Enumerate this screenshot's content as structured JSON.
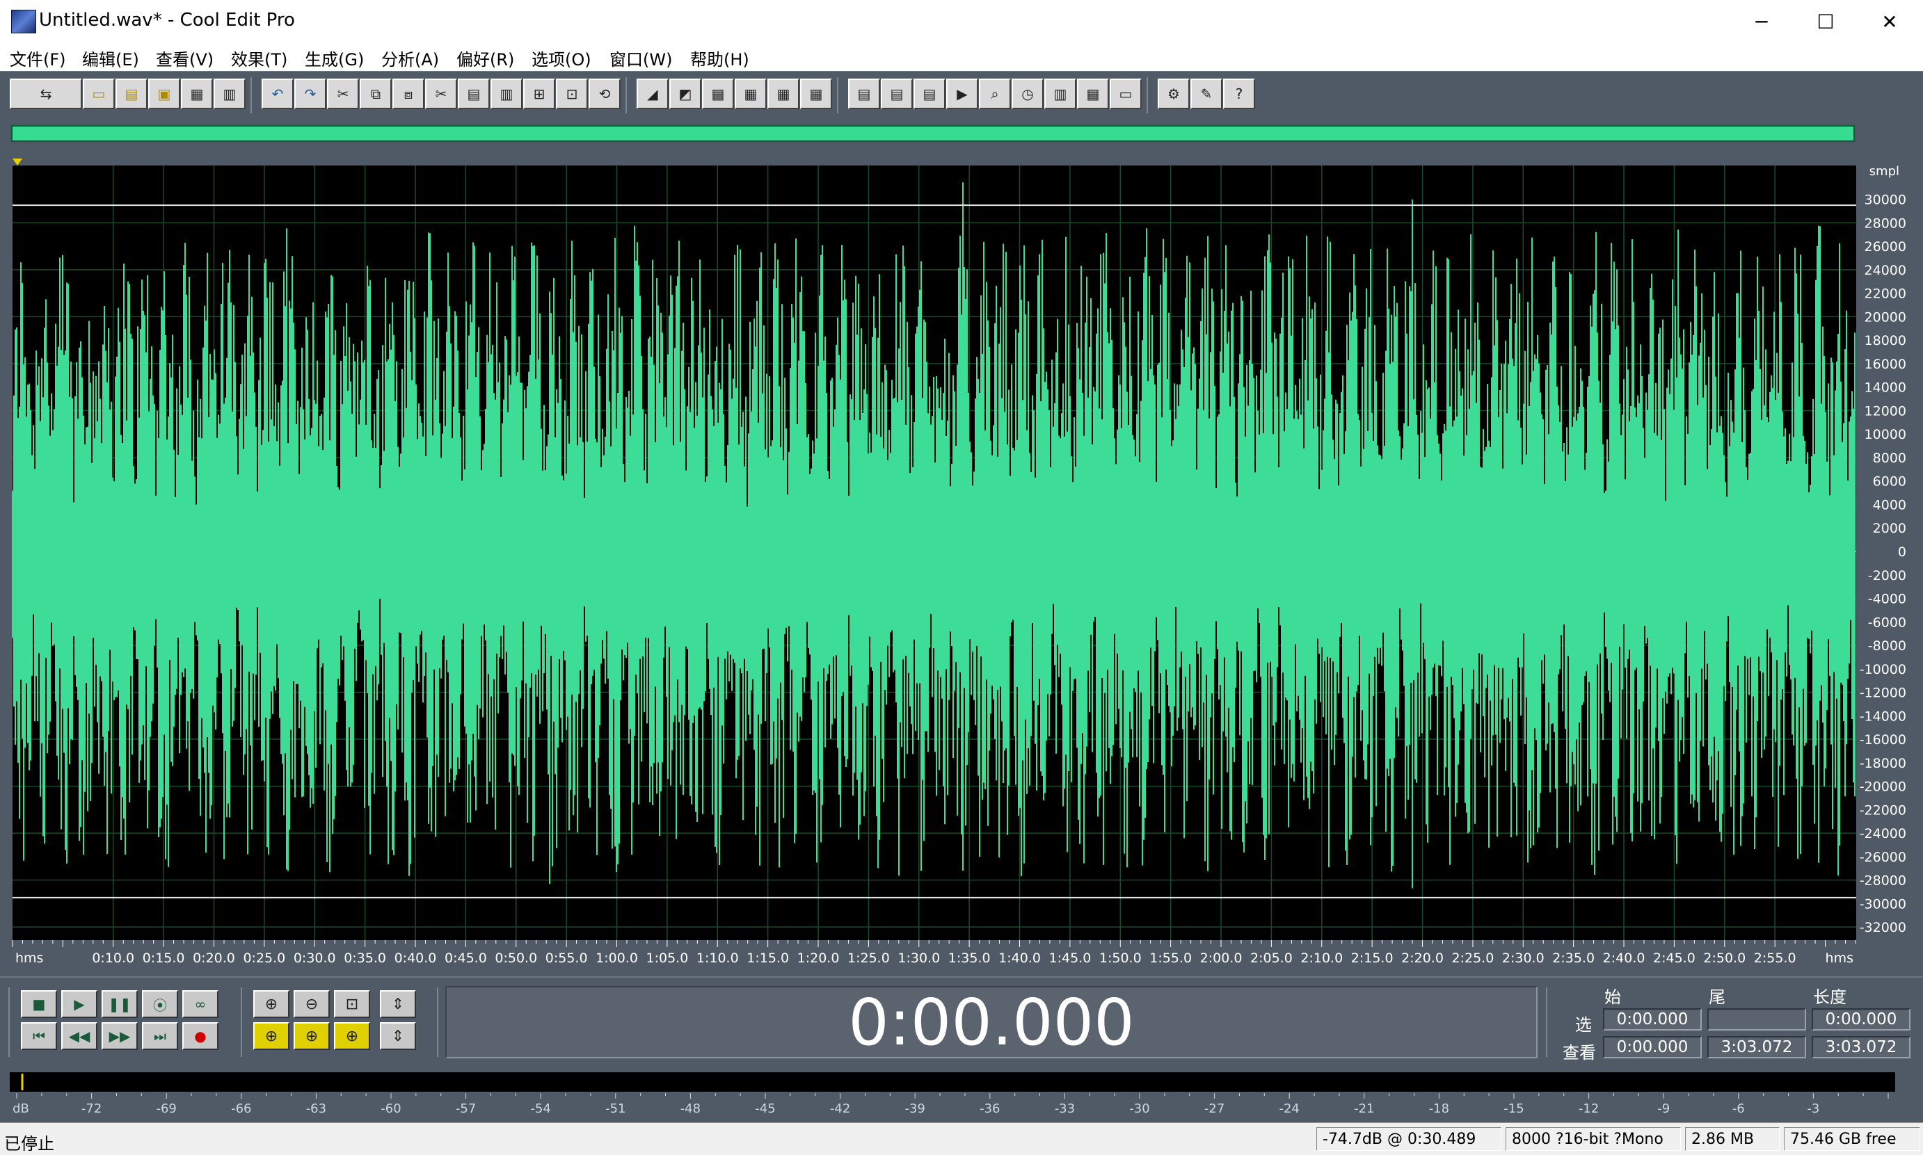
{
  "window": {
    "title": "Untitled.wav* - Cool Edit Pro",
    "minimize": "─",
    "maximize": "☐",
    "close": "✕"
  },
  "menu": [
    {
      "label": "文件(F)"
    },
    {
      "label": "编辑(E)"
    },
    {
      "label": "查看(V)"
    },
    {
      "label": "效果(T)"
    },
    {
      "label": "生成(G)"
    },
    {
      "label": "分析(A)"
    },
    {
      "label": "偏好(R)"
    },
    {
      "label": "选项(O)"
    },
    {
      "label": "窗口(W)"
    },
    {
      "label": "帮助(H)"
    }
  ],
  "toolbar_icons": [
    "multitrack-toggle-icon",
    "new-file-icon",
    "open-file-icon",
    "save-icon",
    "save-all-icon",
    "close-file-icon",
    "undo-icon",
    "redo-icon",
    "cut-tool-icon",
    "copy-icon",
    "copy-new-icon",
    "cut-icon",
    "paste-icon",
    "paste-new-icon",
    "mix-paste-icon",
    "trim-icon",
    "loop-icon",
    "waveform-view-icon",
    "spectral-view-icon",
    "zoom-a-icon",
    "zoom-b-icon",
    "zoom-c-icon",
    "zoom-d-icon",
    "cue-list-icon",
    "play-list-icon",
    "info-icon",
    "play-view-icon",
    "magnify-icon",
    "time-icon",
    "bars-icon",
    "colors-icon",
    "lines-icon",
    "settings-icon",
    "tools-icon",
    "help-icon"
  ],
  "colors": {
    "waveform": "#3ddc97",
    "waveform_bg": "#000000",
    "grid": "#1a4a2a",
    "frame": "#4f5a66"
  },
  "waveform": {
    "y_unit": "smpl",
    "y_ticks": [
      "30000",
      "28000",
      "26000",
      "24000",
      "22000",
      "20000",
      "18000",
      "16000",
      "14000",
      "12000",
      "10000",
      "8000",
      "6000",
      "4000",
      "2000",
      "0",
      "-2000",
      "-4000",
      "-6000",
      "-8000",
      "-10000",
      "-12000",
      "-14000",
      "-16000",
      "-18000",
      "-20000",
      "-22000",
      "-24000",
      "-26000",
      "-28000",
      "-30000",
      "-32000"
    ],
    "x_unit": "hms",
    "x_ticks": [
      "0:10.0",
      "0:15.0",
      "0:20.0",
      "0:25.0",
      "0:30.0",
      "0:35.0",
      "0:40.0",
      "0:45.0",
      "0:50.0",
      "0:55.0",
      "1:00.0",
      "1:05.0",
      "1:10.0",
      "1:15.0",
      "1:20.0",
      "1:25.0",
      "1:30.0",
      "1:35.0",
      "1:40.0",
      "1:45.0",
      "1:50.0",
      "1:55.0",
      "2:00.0",
      "2:05.0",
      "2:10.0",
      "2:15.0",
      "2:20.0",
      "2:25.0",
      "2:30.0",
      "2:35.0",
      "2:40.0",
      "2:45.0",
      "2:50.0",
      "2:55.0"
    ],
    "x_right_unit": "hms",
    "clip_line_level": 29500
  },
  "transport_icons": [
    "stop-icon",
    "play-icon",
    "pause-icon",
    "play-to-end-icon",
    "loop-play-icon",
    "go-to-start-icon",
    "rewind-icon",
    "fast-forward-icon",
    "go-to-end-icon",
    "record-icon"
  ],
  "zoom_icons": [
    "zoom-in-icon",
    "zoom-out-icon",
    "zoom-full-icon",
    "zoom-in-vertical-icon",
    "zoom-left-icon",
    "zoom-right-icon",
    "zoom-selection-icon",
    "zoom-out-vertical-icon"
  ],
  "time_display": "0:00.000",
  "selection": {
    "col_begin": "始",
    "col_end": "尾",
    "col_length": "长度",
    "row_select": "选",
    "row_view": "查看",
    "select_begin": "0:00.000",
    "select_end": "",
    "select_length": "0:00.000",
    "view_begin": "0:00.000",
    "view_end": "3:03.072",
    "view_length": "3:03.072"
  },
  "meter": {
    "ticks": [
      "dB",
      "-72",
      "-69",
      "-66",
      "-63",
      "-60",
      "-57",
      "-54",
      "-51",
      "-48",
      "-45",
      "-42",
      "-39",
      "-36",
      "-33",
      "-30",
      "-27",
      "-24",
      "-21",
      "-18",
      "-15",
      "-12",
      "-9",
      "-6",
      "-3"
    ]
  },
  "status": {
    "state": "已停止",
    "cursor": "-74.7dB @   0:30.489",
    "format": "8000 ?16-bit ?Mono",
    "size": "2.86 MB",
    "free": "75.46 GB free"
  }
}
